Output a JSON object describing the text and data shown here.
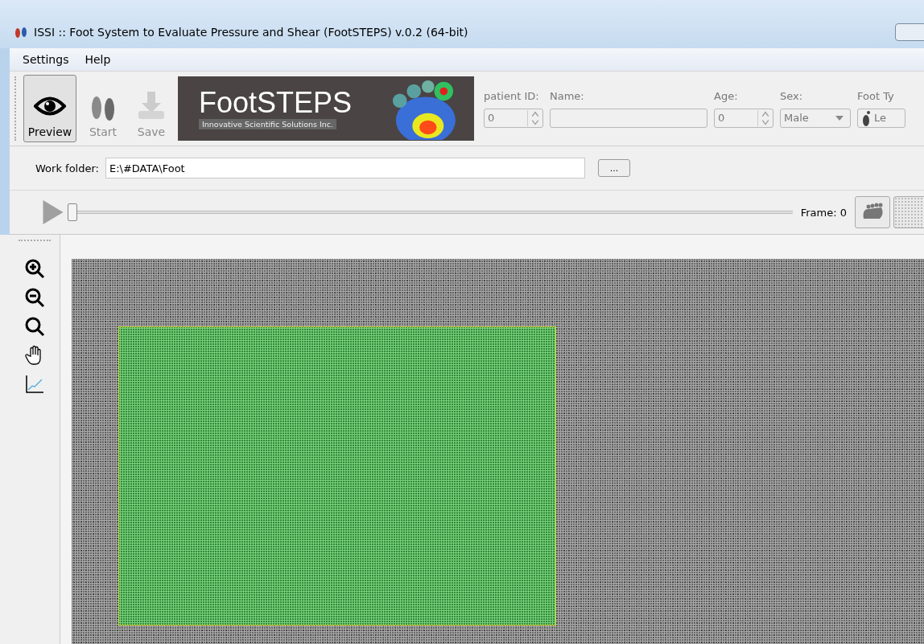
{
  "window": {
    "title": "ISSI :: Foot System to Evaluate Pressure and Shear (FootSTEPS) v.0.2 (64-bit)"
  },
  "menu": [
    "Settings",
    "Help"
  ],
  "toolbar": [
    {
      "kind": "preview",
      "label": "Preview",
      "checked": true,
      "disabled": false
    },
    {
      "kind": "start",
      "label": "Start",
      "checked": false,
      "disabled": true
    },
    {
      "kind": "save",
      "label": "Save",
      "checked": false,
      "disabled": true
    }
  ],
  "logo": {
    "title": "FootSTEPS",
    "subtitle": "Innovative Scientific Solutions Inc."
  },
  "patient": {
    "disabled": true,
    "id_label": "patient ID:",
    "id_value": "0",
    "name_label": "Name:",
    "age_label": "Age:",
    "age_value": "0",
    "sex_label": "Sex:",
    "sex_value": "Male",
    "foot_label": "Foot Ty",
    "foot_value": "Le"
  },
  "work_folder": {
    "label": "Work folder:",
    "value": "E:\\#DATA\\Foot",
    "browse": "..."
  },
  "playback": {
    "level": 0,
    "frame_label": "Frame: 0"
  }
}
